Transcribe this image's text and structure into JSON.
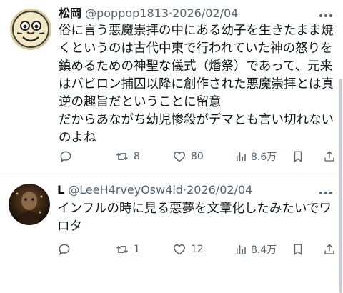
{
  "tweets": [
    {
      "name": "松岡",
      "handle": "@poppop1813",
      "sep": "·",
      "date": "2026/02/04",
      "avatar_icon": "smiling-cartoon-face-icon",
      "text": "俗に言う悪魔崇拝の中にある幼子を生きたまま焼\nくというのは古代中東で行われていた神の怒りを\n鎮めるための神聖な儀式（燔祭）であって、元来\nはバビロン捕囚以降に創作された悪魔崇拝とは真\n逆の趣旨だということに留意\nだからあながち幼児惨殺がデマとも言い切れない\nのよね",
      "replies": "",
      "retweets": "8",
      "likes": "80",
      "views": "8.6万"
    },
    {
      "name": "L",
      "handle": "@LeeH4rveyOsw4ld",
      "sep": "·",
      "date": "2026/02/04",
      "avatar_icon": "dark-portrait-avatar-icon",
      "text": "インフルの時に見る悪夢を文章化したみたいでワ\nロタ",
      "replies": "",
      "retweets": "1",
      "likes": "12",
      "views": "8.4万"
    }
  ],
  "icons": {
    "more": "more-options-icon",
    "reply": "reply-icon",
    "retweet": "retweet-icon",
    "like": "heart-icon",
    "views": "views-chart-icon",
    "bookmark": "bookmark-icon",
    "share": "share-icon"
  },
  "colors": {
    "text": "#0f1419",
    "secondary": "#536471",
    "divider": "#eff3f4"
  }
}
